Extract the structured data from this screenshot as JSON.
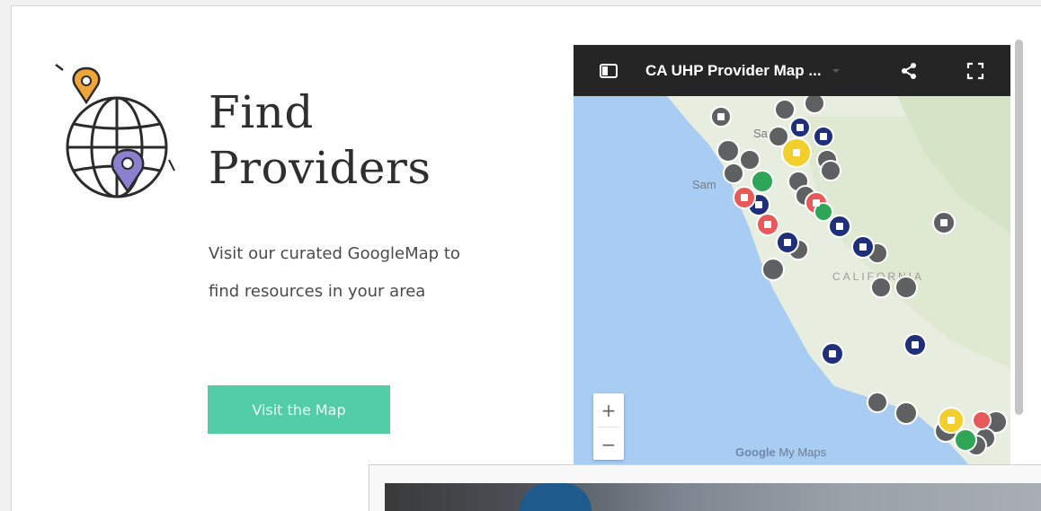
{
  "section": {
    "title_line1": "Find",
    "title_line2": "Providers",
    "description_line1": "Visit our curated GoogleMap to",
    "description_line2": "find resources in your area",
    "button_label": "Visit the Map",
    "icon": "globe-location-pin-icon"
  },
  "map": {
    "title": "CA UHP Provider Map ...",
    "zoom_in_label": "+",
    "zoom_out_label": "−",
    "attribution_brand": "Google",
    "attribution_product": "My Maps",
    "labels": [
      "San",
      "Sam",
      "CALIFORNIA"
    ],
    "icons": {
      "legend": "legend-panel-icon",
      "dropdown": "dropdown-icon",
      "share": "share-icon",
      "fullscreen": "fullscreen-icon"
    }
  },
  "colors": {
    "accent_button": "#53cda6",
    "map_header": "#252525",
    "water": "#a9cdf2",
    "land": "#e8eedf",
    "marker_gray": "#5f6062",
    "marker_navy": "#1f2f7a",
    "marker_red": "#e85a5a",
    "marker_green": "#2ea657",
    "marker_yellow": "#f2cf2d"
  }
}
